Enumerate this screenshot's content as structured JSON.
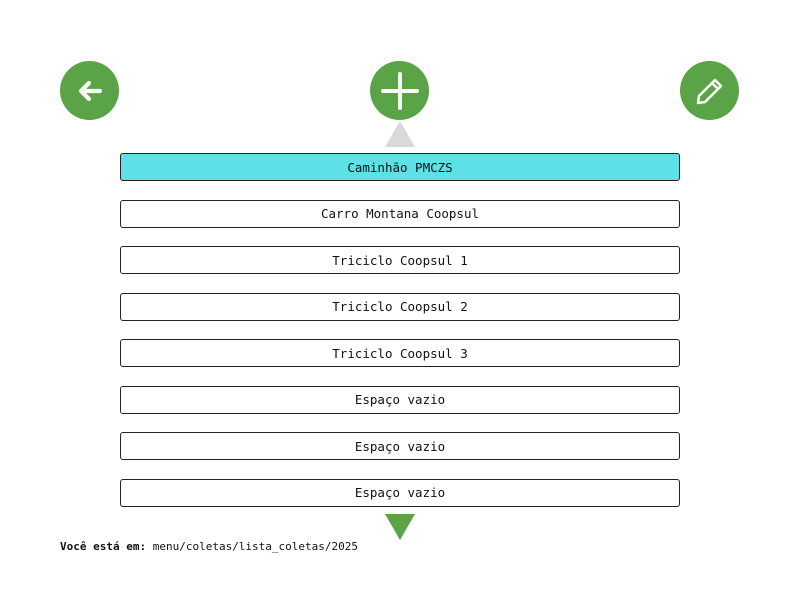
{
  "toolbar": {
    "back_icon": "arrow-left-icon",
    "add_icon": "plus-icon",
    "edit_icon": "pencil-icon",
    "accent_color": "#5aa346"
  },
  "list": {
    "items": [
      {
        "label": "Caminhão PMCZS",
        "selected": true
      },
      {
        "label": "Carro Montana Coopsul",
        "selected": false
      },
      {
        "label": "Triciclo Coopsul 1",
        "selected": false
      },
      {
        "label": "Triciclo Coopsul 2",
        "selected": false
      },
      {
        "label": "Triciclo Coopsul 3",
        "selected": false
      },
      {
        "label": "Espaço vazio",
        "selected": false
      },
      {
        "label": "Espaço vazio",
        "selected": false
      },
      {
        "label": "Espaço vazio",
        "selected": false
      }
    ],
    "selected_color": "#5de0e6"
  },
  "breadcrumb": {
    "label": "Você está em:",
    "path": "menu/coletas/lista_coletas/2025"
  }
}
